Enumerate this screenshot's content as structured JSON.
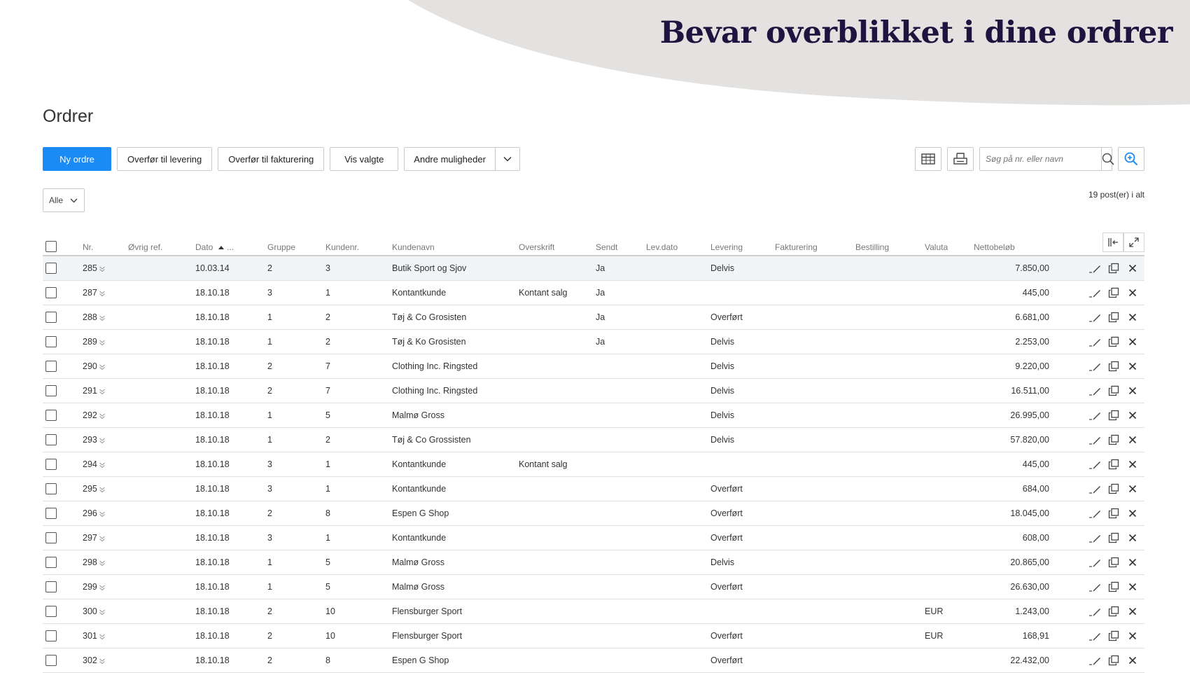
{
  "hero": {
    "title": "Bevar overblikket i dine ordrer"
  },
  "page": {
    "title": "Ordrer"
  },
  "toolbar": {
    "new_order": "Ny ordre",
    "to_delivery": "Overfør til levering",
    "to_invoicing": "Overfør til fakturering",
    "show_selected": "Vis valgte",
    "more_options": "Andre muligheder"
  },
  "search": {
    "placeholder": "Søg på nr. eller navn"
  },
  "filter": {
    "selected": "Alle"
  },
  "count_text": "19 post(er) i alt",
  "colors": {
    "primary": "#1a8af5",
    "banner": "#e3e2e0",
    "hero_text": "#1e1440"
  },
  "table": {
    "headers": {
      "nr": "Nr.",
      "ref": "Øvrig ref.",
      "date": "Dato",
      "date_more": "...",
      "group": "Gruppe",
      "customer_no": "Kundenr.",
      "customer_name": "Kundenavn",
      "heading": "Overskrift",
      "sent": "Sendt",
      "delivery_date": "Lev.dato",
      "delivery": "Levering",
      "invoicing": "Fakturering",
      "ordering": "Bestilling",
      "currency": "Valuta",
      "net": "Nettobeløb"
    },
    "rows": [
      {
        "nr": "285",
        "ref": "",
        "date": "10.03.14",
        "group": "2",
        "customer_no": "3",
        "customer_name": "Butik Sport og Sjov",
        "heading": "",
        "sent": "Ja",
        "delivery_date": "",
        "delivery": "Delvis",
        "invoicing": "",
        "ordering": "",
        "currency": "",
        "net": "7.850,00"
      },
      {
        "nr": "287",
        "ref": "",
        "date": "18.10.18",
        "group": "3",
        "customer_no": "1",
        "customer_name": "Kontantkunde",
        "heading": "Kontant salg",
        "sent": "Ja",
        "delivery_date": "",
        "delivery": "",
        "invoicing": "",
        "ordering": "",
        "currency": "",
        "net": "445,00"
      },
      {
        "nr": "288",
        "ref": "",
        "date": "18.10.18",
        "group": "1",
        "customer_no": "2",
        "customer_name": "Tøj & Co Grosisten",
        "heading": "",
        "sent": "Ja",
        "delivery_date": "",
        "delivery": "Overført",
        "invoicing": "",
        "ordering": "",
        "currency": "",
        "net": "6.681,00"
      },
      {
        "nr": "289",
        "ref": "",
        "date": "18.10.18",
        "group": "1",
        "customer_no": "2",
        "customer_name": "Tøj & Ko Grosisten",
        "heading": "",
        "sent": "Ja",
        "delivery_date": "",
        "delivery": "Delvis",
        "invoicing": "",
        "ordering": "",
        "currency": "",
        "net": "2.253,00"
      },
      {
        "nr": "290",
        "ref": "",
        "date": "18.10.18",
        "group": "2",
        "customer_no": "7",
        "customer_name": "Clothing Inc. Ringsted",
        "heading": "",
        "sent": "",
        "delivery_date": "",
        "delivery": "Delvis",
        "invoicing": "",
        "ordering": "",
        "currency": "",
        "net": "9.220,00"
      },
      {
        "nr": "291",
        "ref": "",
        "date": "18.10.18",
        "group": "2",
        "customer_no": "7",
        "customer_name": "Clothing Inc. Ringsted",
        "heading": "",
        "sent": "",
        "delivery_date": "",
        "delivery": "Delvis",
        "invoicing": "",
        "ordering": "",
        "currency": "",
        "net": "16.511,00"
      },
      {
        "nr": "292",
        "ref": "",
        "date": "18.10.18",
        "group": "1",
        "customer_no": "5",
        "customer_name": "Malmø Gross",
        "heading": "",
        "sent": "",
        "delivery_date": "",
        "delivery": "Delvis",
        "invoicing": "",
        "ordering": "",
        "currency": "",
        "net": "26.995,00"
      },
      {
        "nr": "293",
        "ref": "",
        "date": "18.10.18",
        "group": "1",
        "customer_no": "2",
        "customer_name": "Tøj & Co Grossisten",
        "heading": "",
        "sent": "",
        "delivery_date": "",
        "delivery": "Delvis",
        "invoicing": "",
        "ordering": "",
        "currency": "",
        "net": "57.820,00"
      },
      {
        "nr": "294",
        "ref": "",
        "date": "18.10.18",
        "group": "3",
        "customer_no": "1",
        "customer_name": "Kontantkunde",
        "heading": "Kontant salg",
        "sent": "",
        "delivery_date": "",
        "delivery": "",
        "invoicing": "",
        "ordering": "",
        "currency": "",
        "net": "445,00"
      },
      {
        "nr": "295",
        "ref": "",
        "date": "18.10.18",
        "group": "3",
        "customer_no": "1",
        "customer_name": "Kontantkunde",
        "heading": "",
        "sent": "",
        "delivery_date": "",
        "delivery": "Overført",
        "invoicing": "",
        "ordering": "",
        "currency": "",
        "net": "684,00"
      },
      {
        "nr": "296",
        "ref": "",
        "date": "18.10.18",
        "group": "2",
        "customer_no": "8",
        "customer_name": "Espen G Shop",
        "heading": "",
        "sent": "",
        "delivery_date": "",
        "delivery": "Overført",
        "invoicing": "",
        "ordering": "",
        "currency": "",
        "net": "18.045,00"
      },
      {
        "nr": "297",
        "ref": "",
        "date": "18.10.18",
        "group": "3",
        "customer_no": "1",
        "customer_name": "Kontantkunde",
        "heading": "",
        "sent": "",
        "delivery_date": "",
        "delivery": "Overført",
        "invoicing": "",
        "ordering": "",
        "currency": "",
        "net": "608,00"
      },
      {
        "nr": "298",
        "ref": "",
        "date": "18.10.18",
        "group": "1",
        "customer_no": "5",
        "customer_name": "Malmø Gross",
        "heading": "",
        "sent": "",
        "delivery_date": "",
        "delivery": "Delvis",
        "invoicing": "",
        "ordering": "",
        "currency": "",
        "net": "20.865,00"
      },
      {
        "nr": "299",
        "ref": "",
        "date": "18.10.18",
        "group": "1",
        "customer_no": "5",
        "customer_name": "Malmø Gross",
        "heading": "",
        "sent": "",
        "delivery_date": "",
        "delivery": "Overført",
        "invoicing": "",
        "ordering": "",
        "currency": "",
        "net": "26.630,00"
      },
      {
        "nr": "300",
        "ref": "",
        "date": "18.10.18",
        "group": "2",
        "customer_no": "10",
        "customer_name": "Flensburger Sport",
        "heading": "",
        "sent": "",
        "delivery_date": "",
        "delivery": "",
        "invoicing": "",
        "ordering": "",
        "currency": "EUR",
        "net": "1.243,00"
      },
      {
        "nr": "301",
        "ref": "",
        "date": "18.10.18",
        "group": "2",
        "customer_no": "10",
        "customer_name": "Flensburger Sport",
        "heading": "",
        "sent": "",
        "delivery_date": "",
        "delivery": "Overført",
        "invoicing": "",
        "ordering": "",
        "currency": "EUR",
        "net": "168,91"
      },
      {
        "nr": "302",
        "ref": "",
        "date": "18.10.18",
        "group": "2",
        "customer_no": "8",
        "customer_name": "Espen G Shop",
        "heading": "",
        "sent": "",
        "delivery_date": "",
        "delivery": "Overført",
        "invoicing": "",
        "ordering": "",
        "currency": "",
        "net": "22.432,00"
      }
    ]
  }
}
